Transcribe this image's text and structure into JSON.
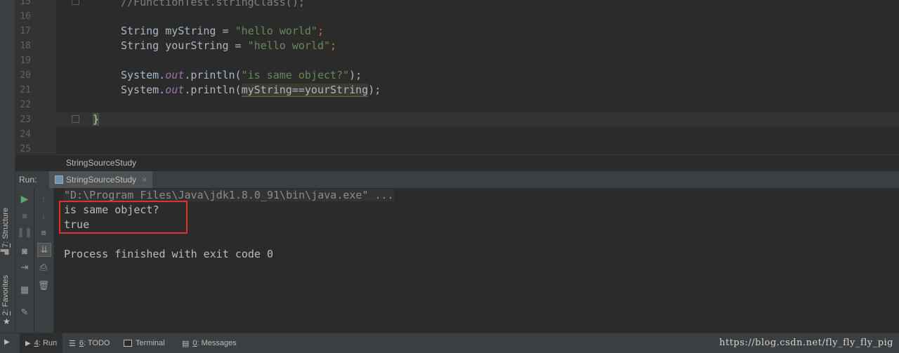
{
  "editor": {
    "lines": [
      {
        "num": "15",
        "text": "//FunctionTest.stringClass();"
      },
      {
        "num": "16",
        "text": ""
      },
      {
        "num": "17",
        "decl_type": "String",
        "var": "myString",
        "op": " = ",
        "value": "\"hello world\"",
        "end": ";"
      },
      {
        "num": "18",
        "decl_type": "String",
        "var": "yourString",
        "op": " = ",
        "value": "\"hello world\"",
        "end": ";"
      },
      {
        "num": "19",
        "text": ""
      },
      {
        "num": "20",
        "obj": "System.",
        "field": "out",
        "call": ".println(",
        "arg": "\"is same object?\"",
        "end": ");"
      },
      {
        "num": "21",
        "obj": "System.",
        "field": "out",
        "call": ".println(",
        "arg": "myString==yourString",
        "end": ");"
      },
      {
        "num": "22",
        "text": ""
      },
      {
        "num": "23",
        "text": "}"
      },
      {
        "num": "24",
        "text": ""
      },
      {
        "num": "25",
        "text": ""
      }
    ],
    "breadcrumb": "StringSourceStudy"
  },
  "run_panel": {
    "label": "Run:",
    "tab_label": "StringSourceStudy",
    "tab_close": "×",
    "console": {
      "command": "\"D:\\Program Files\\Java\\jdk1.8.0_91\\bin\\java.exe\" ...",
      "output": [
        "is same object?",
        "true"
      ],
      "exit": "Process finished with exit code 0"
    }
  },
  "left_strip": {
    "structure_prefix": "7",
    "structure_label": ": Structure",
    "favorites_prefix": "2",
    "favorites_label": ": Favorites"
  },
  "bottom_tabs": [
    {
      "num": "4",
      "label": ": Run",
      "icon": "play-icon"
    },
    {
      "num": "6",
      "label": ": TODO",
      "icon": "todo-icon"
    },
    {
      "num": "",
      "label": "Terminal",
      "icon": "terminal-icon"
    },
    {
      "num": "0",
      "label": ": Messages",
      "icon": "messages-icon"
    }
  ],
  "watermark": "https://blog.csdn.net/fly_fly_fly_pig",
  "colors": {
    "string": "#6a8759",
    "field": "#9876aa",
    "text": "#a9b7c6",
    "highlight_box": "#e03030"
  }
}
